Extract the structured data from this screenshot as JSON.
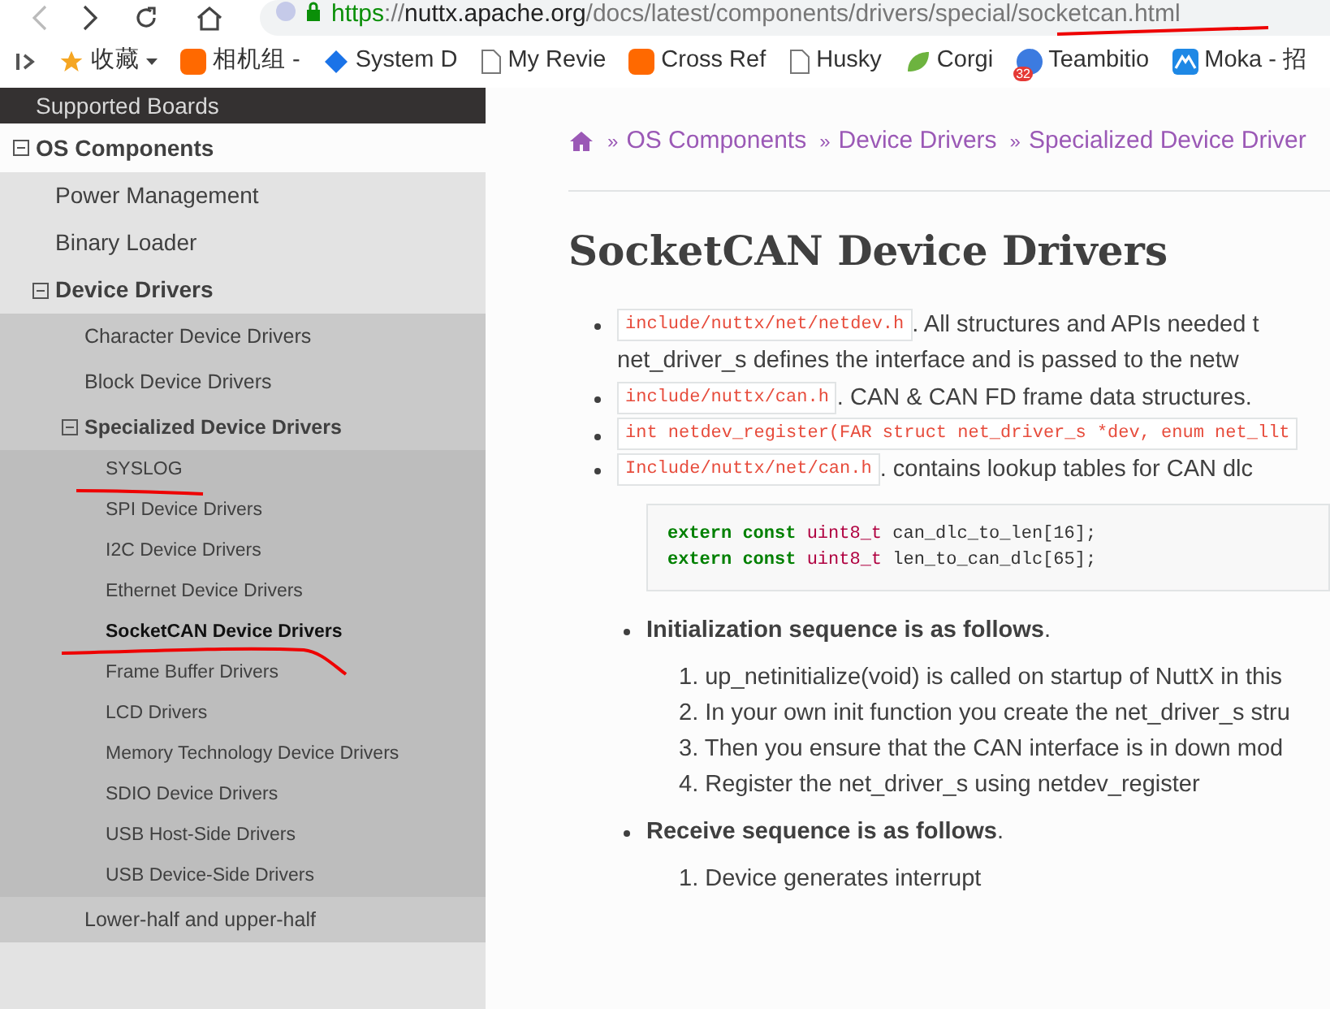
{
  "browser": {
    "url_host": "https://nuttx.apache.org",
    "url_path": "/docs/latest/components/drivers/special/socketcan.html",
    "bookmarks": [
      {
        "label": "收藏",
        "kind": "star"
      },
      {
        "label": "相机组 -",
        "kind": "mi"
      },
      {
        "label": "System D",
        "kind": "diamond"
      },
      {
        "label": "My Revie",
        "kind": "page"
      },
      {
        "label": "Cross Ref",
        "kind": "mi"
      },
      {
        "label": "Husky",
        "kind": "page"
      },
      {
        "label": "Corgi",
        "kind": "leaf"
      },
      {
        "label": "Teambitio",
        "kind": "badge",
        "badge": "32"
      },
      {
        "label": "Moka - 招",
        "kind": "moka"
      }
    ]
  },
  "sidebar": {
    "items": [
      {
        "label": "Supported Boards",
        "selected": false
      },
      {
        "label": "OS Components",
        "selected": false,
        "expanded": true,
        "children": [
          {
            "label": "Power Management",
            "selected": false
          },
          {
            "label": "Binary Loader",
            "selected": false
          },
          {
            "label": "Device Drivers",
            "selected": false,
            "expanded": true,
            "children": [
              {
                "label": "Character Device Drivers",
                "selected": false
              },
              {
                "label": "Block Device Drivers",
                "selected": false
              },
              {
                "label": "Specialized Device Drivers",
                "selected": false,
                "expanded": true,
                "children": [
                  {
                    "label": "SYSLOG",
                    "selected": false
                  },
                  {
                    "label": "SPI Device Drivers",
                    "selected": false
                  },
                  {
                    "label": "I2C Device Drivers",
                    "selected": false
                  },
                  {
                    "label": "Ethernet Device Drivers",
                    "selected": false
                  },
                  {
                    "label": "SocketCAN Device Drivers",
                    "selected": true
                  },
                  {
                    "label": "Frame Buffer Drivers",
                    "selected": false
                  },
                  {
                    "label": "LCD Drivers",
                    "selected": false
                  },
                  {
                    "label": "Memory Technology Device Drivers",
                    "selected": false
                  },
                  {
                    "label": "SDIO Device Drivers",
                    "selected": false
                  },
                  {
                    "label": "USB Host-Side Drivers",
                    "selected": false
                  },
                  {
                    "label": "USB Device-Side Drivers",
                    "selected": false
                  }
                ]
              },
              {
                "label": "Lower-half and upper-half",
                "selected": false
              }
            ]
          }
        ]
      }
    ]
  },
  "breadcrumbs": [
    "OS Components",
    "Device Drivers",
    "Specialized Device Driver"
  ],
  "separator": "»",
  "title": "SocketCAN Device Drivers",
  "bullets": [
    {
      "code": "include/nuttx/net/netdev.h",
      "text": ". All structures and APIs needed t",
      "more": "net_driver_s defines the interface and is passed to the netw"
    },
    {
      "code": "include/nuttx/can.h",
      "text": ". CAN & CAN FD frame data structures."
    },
    {
      "code": "int netdev_register(FAR struct net_driver_s *dev, enum net_llt"
    },
    {
      "code": "Include/nuttx/net/can.h",
      "text": ". contains lookup tables for CAN dlc"
    }
  ],
  "code_block": [
    [
      "extern",
      "const",
      "uint8_t",
      "can_dlc_to_len[16];"
    ],
    [
      "extern",
      "const",
      "uint8_t",
      "len_to_can_dlc[65];"
    ]
  ],
  "sections": [
    {
      "heading": "**Initialization sequence is as follows**.",
      "steps": [
        "1. up_netinitialize(void) is called on startup of NuttX in this",
        "2. In your own init function you create the net_driver_s stru",
        "3. Then you ensure that the CAN interface is in down mod",
        "4. Register the net_driver_s using netdev_register"
      ]
    },
    {
      "heading": "**Receive sequence is as follows**.",
      "steps": [
        "1. Device generates interrupt"
      ]
    }
  ]
}
